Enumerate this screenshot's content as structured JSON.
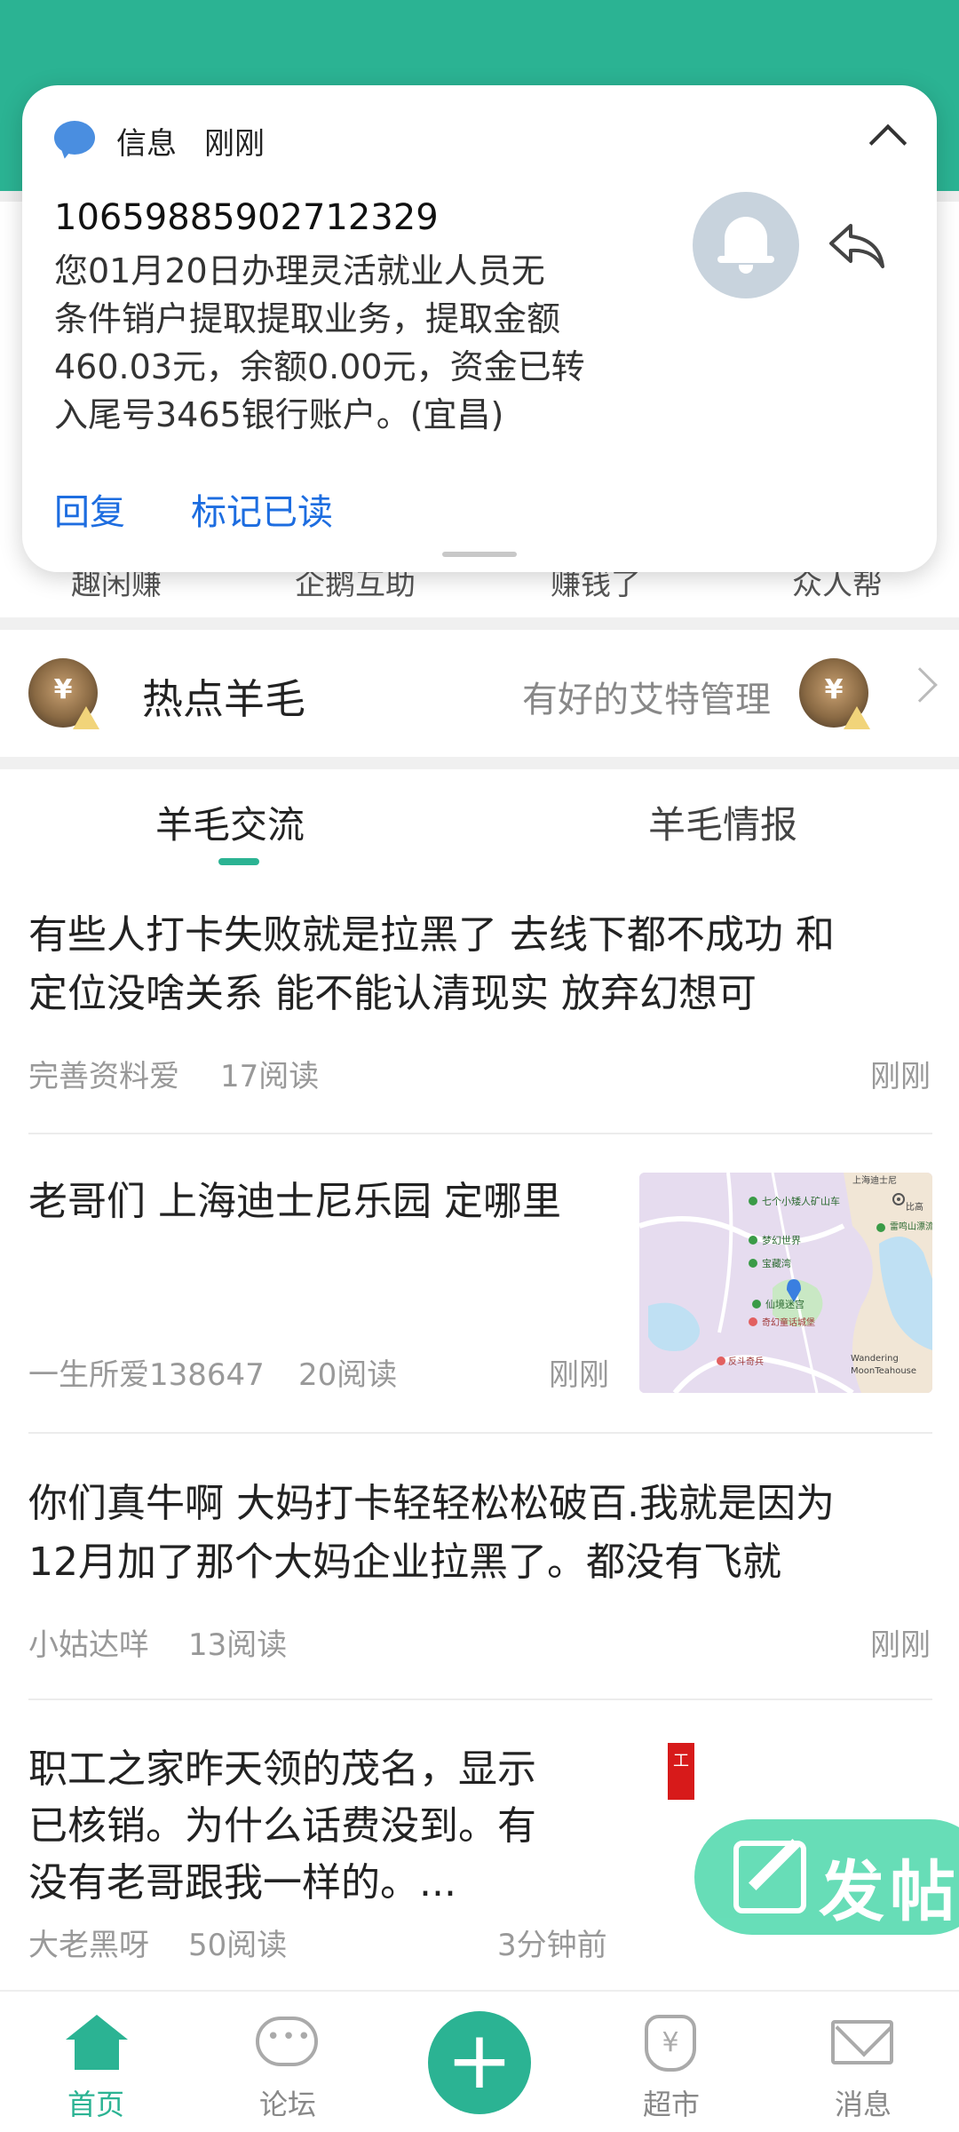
{
  "quick_entries": [
    "趣闲赚",
    "企鹅互助",
    "赚钱了",
    "众人帮"
  ],
  "hot": {
    "title": "热点羊毛",
    "user": "有好的艾特管理",
    "coin_symbol": "¥"
  },
  "tabs": [
    {
      "label": "羊毛交流",
      "active": true
    },
    {
      "label": "羊毛情报",
      "active": false
    }
  ],
  "posts": [
    {
      "text_lines": [
        "有些人打卡失败就是拉黑了 去线下都不成功 和",
        "定位没啥关系 能不能认清现实 放弃幻想可"
      ],
      "author": "完善资料爱",
      "reads": "17阅读",
      "time": "刚刚"
    },
    {
      "text_lines": [
        "老哥们 上海迪士尼乐园 定哪里"
      ],
      "author": "一生所爱138647",
      "reads": "20阅读",
      "time": "刚刚",
      "thumbnail": "map",
      "map_labels": [
        "上海迪士尼",
        "比高",
        "七个小矮人矿山车",
        "梦幻世界",
        "宝藏湾",
        "雷鸣山漂流",
        "仙境迷宫",
        "Wandering",
        "MoonTeahouse",
        "奇幻童话城堡",
        "反斗奇兵"
      ]
    },
    {
      "text_lines": [
        "你们真牛啊 大妈打卡轻轻松松破百.我就是因为",
        "12月加了那个大妈企业拉黑了。都没有飞就"
      ],
      "author": "小姑达咩",
      "reads": "13阅读",
      "time": "刚刚"
    },
    {
      "text_lines": [
        "职工之家昨天领的茂名，显示",
        "已核销。为什么话费没到。有",
        "没有老哥跟我一样的。..."
      ],
      "author": "大老黑呀",
      "reads": "50阅读",
      "time": "3分钟前",
      "thumbnail_mark": "工"
    }
  ],
  "fab": {
    "label": "发帖",
    "icon": "edit-icon"
  },
  "bottom_nav": [
    {
      "label": "首页",
      "icon": "home-icon",
      "active": true
    },
    {
      "label": "论坛",
      "icon": "chat-bubble-icon",
      "active": false
    },
    {
      "label": "+",
      "icon": "add-icon",
      "active": false
    },
    {
      "label": "超市",
      "icon": "money-bag-icon",
      "active": false
    },
    {
      "label": "消息",
      "icon": "mail-icon",
      "active": false
    }
  ],
  "notification": {
    "app": "信息",
    "time": "刚刚",
    "sender": "10659885902712329",
    "body_lines": [
      "您01月20日办理灵活就业人员无",
      "条件销户提取提取业务，提取金额",
      "460.03元，余额0.00元，资金已转",
      "入尾号3465银行账户。(宜昌)"
    ],
    "actions": [
      "回复",
      "标记已读"
    ]
  },
  "colors": {
    "brand_green": "#2bb393",
    "link_blue": "#1d6de0",
    "fab_green": "#5fdcb4"
  }
}
